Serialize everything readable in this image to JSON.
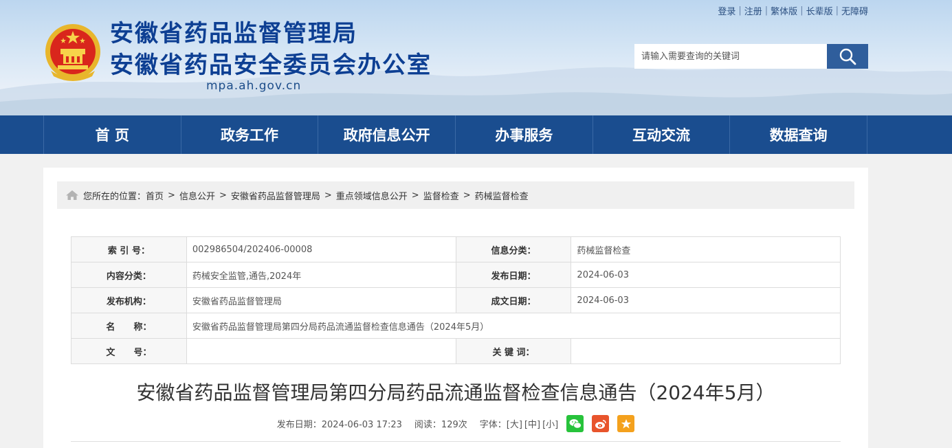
{
  "header": {
    "title_line1": "安徽省药品监督管理局",
    "title_line2": "安徽省药品安全委员会办公室",
    "domain": "mpa.ah.gov.cn",
    "top_links": [
      "登录",
      "注册",
      "繁体版",
      "长辈版",
      "无障碍"
    ],
    "search_placeholder": "请输入需要查询的关键词"
  },
  "nav": {
    "items": [
      "首 页",
      "政务工作",
      "政府信息公开",
      "办事服务",
      "互动交流",
      "数据查询"
    ]
  },
  "breadcrumb": {
    "prefix": "您所在的位置：",
    "items": [
      "首页",
      "信息公开",
      "安徽省药品监督管理局",
      "重点领域信息公开",
      "监督检查",
      "药械监督检查"
    ],
    "separator": ">"
  },
  "meta": {
    "index_label": "索 引 号：",
    "index_value": "002986504/202406-00008",
    "category_label": "信息分类：",
    "category_value": "药械监督检查",
    "content_label": "内容分类：",
    "content_value": "药械安全监管,通告,2024年",
    "pubdate_label": "发布日期：",
    "pubdate_value": "2024-06-03",
    "org_label": "发布机构：",
    "org_value": "安徽省药品监督管理局",
    "writedate_label": "成文日期：",
    "writedate_value": "2024-06-03",
    "name_label": "名      称：",
    "name_value": "安徽省药品监督管理局第四分局药品流通监督检查信息通告（2024年5月）",
    "docno_label": "文      号：",
    "docno_value": "",
    "keyword_label": "关 键 词：",
    "keyword_value": ""
  },
  "article": {
    "title": "安徽省药品监督管理局第四分局药品流通监督检查信息通告（2024年5月）",
    "publish_info": "发布日期：2024-06-03 17:23",
    "read_info": "阅读：129次",
    "font_label": "字体：",
    "font_large": "[大]",
    "font_medium": "[中]",
    "font_small": "[小]"
  },
  "icons": {
    "search": "search-icon",
    "home": "home-icon",
    "wechat": "wechat-icon",
    "weibo": "weibo-icon",
    "favorite": "star-icon"
  },
  "colors": {
    "brand_blue": "#1a4d8f",
    "title_blue": "#0d3f93",
    "search_button": "#2f5e9c",
    "wechat_green": "#27c33b",
    "weibo_orange": "#e8542c",
    "favorite_yellow": "#f4a11d"
  }
}
